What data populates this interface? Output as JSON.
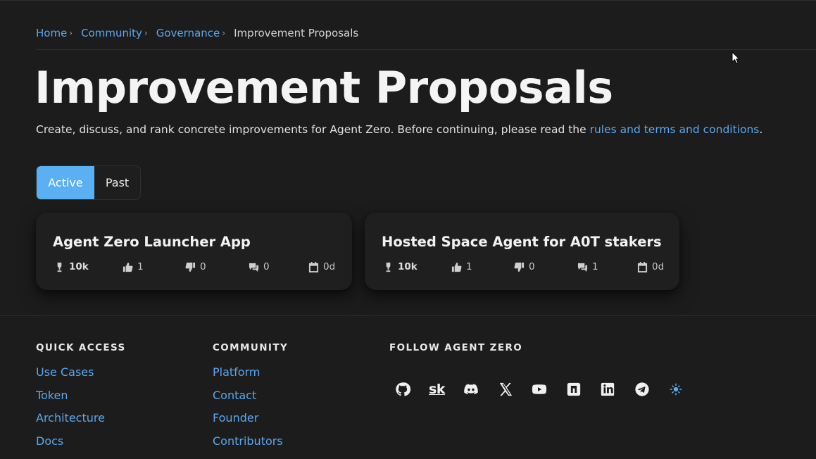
{
  "breadcrumb": {
    "items": [
      "Home",
      "Community",
      "Governance"
    ],
    "separator": "›",
    "current": "Improvement Proposals"
  },
  "page": {
    "title": "Improvement Proposals",
    "subtitle_text": "Create, discuss, and rank concrete improvements for Agent Zero. Before continuing, please read the ",
    "subtitle_link": "rules and terms and conditions",
    "subtitle_end": "."
  },
  "tabs": [
    {
      "label": "Active",
      "selected": true
    },
    {
      "label": "Past",
      "selected": false
    }
  ],
  "proposals": [
    {
      "title": "Agent Zero Launcher App",
      "score": "10k",
      "upvotes": "1",
      "downvotes": "0",
      "comments": "0",
      "age": "0d"
    },
    {
      "title": "Hosted Space Agent for A0T stakers",
      "score": "10k",
      "upvotes": "1",
      "downvotes": "0",
      "comments": "1",
      "age": "0d"
    }
  ],
  "footer": {
    "quick_access": {
      "heading": "QUICK ACCESS",
      "links": [
        "Use Cases",
        "Token",
        "Architecture",
        "Docs"
      ]
    },
    "community": {
      "heading": "COMMUNITY",
      "links": [
        "Platform",
        "Contact",
        "Founder",
        "Contributors"
      ]
    },
    "follow": {
      "heading": "FOLLOW AGENT ZERO",
      "sk_label": "sk",
      "icons": [
        "github-icon",
        "skool-icon",
        "discord-icon",
        "x-icon",
        "youtube-icon",
        "substack-icon",
        "linkedin-icon",
        "telegram-icon",
        "theme-toggle-icon"
      ]
    }
  },
  "colors": {
    "accent": "#5ab0f2",
    "link": "#5aa8ef",
    "background": "#1c1c1c",
    "card": "#1f1f1f"
  }
}
